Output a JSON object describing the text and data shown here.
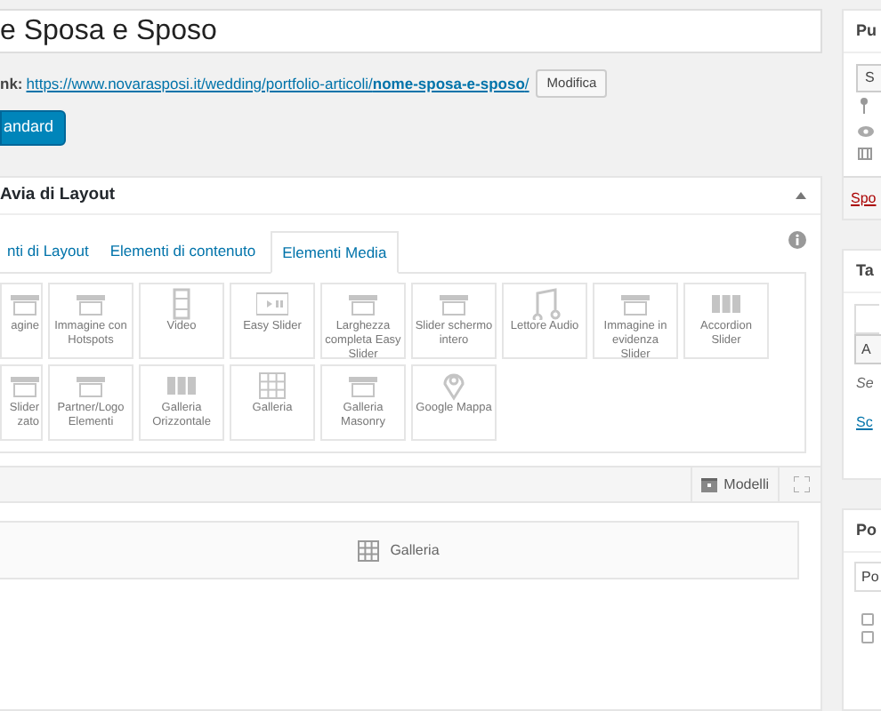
{
  "title_field": {
    "value": "e Sposa e Sposo"
  },
  "permalink": {
    "label": "nk:",
    "url_start": "https://www.novarasposi.it/wedding/portfolio-articoli/",
    "url_slug": "nome-sposa-e-sposo",
    "url_end": "/",
    "edit_button": "Modifica"
  },
  "editor_button": "andard",
  "builder": {
    "title": "Avia di Layout",
    "expanded": true,
    "tabs": [
      {
        "label": "nti di Layout",
        "selected": false
      },
      {
        "label": "Elementi di contenuto",
        "selected": false
      },
      {
        "label": "Elementi Media",
        "selected": true
      }
    ],
    "tile_rows": [
      [
        {
          "label": "agine",
          "cut": true
        },
        {
          "label": "Immagine con Hotspots",
          "cut": false
        },
        {
          "label": "Video",
          "cut": false
        },
        {
          "label": "Easy Slider",
          "cut": false
        },
        {
          "label": "Larghezza completa Easy Slider",
          "cut": false
        },
        {
          "label": "Slider schermo intero",
          "cut": false
        },
        {
          "label": "Lettore Audio",
          "cut": false
        },
        {
          "label": "Immagine in evidenza Slider",
          "cut": false
        },
        {
          "label": "Accordion Slider",
          "cut": false
        }
      ],
      [
        {
          "label": "Slider zato",
          "cut": true
        },
        {
          "label": "Partner/Logo Elementi",
          "cut": false
        },
        {
          "label": "Galleria Orizzontale",
          "cut": false
        },
        {
          "label": "Galleria",
          "cut": false
        },
        {
          "label": "Galleria Masonry",
          "cut": false
        },
        {
          "label": "Google Mappa",
          "cut": false
        }
      ]
    ],
    "templates_button": "Modelli",
    "canvas_elements": [
      {
        "label": "Galleria"
      }
    ]
  },
  "sidebar": {
    "publish": {
      "title": "Pu",
      "button": "S",
      "trash_link": "Spo"
    },
    "tags": {
      "title": "Ta",
      "add_button": "A",
      "hint": "Se",
      "link": "Sc"
    },
    "format": {
      "title": "Po",
      "tab": "Po",
      "checkboxes": [
        {
          "checked": false
        },
        {
          "checked": false
        }
      ]
    }
  }
}
